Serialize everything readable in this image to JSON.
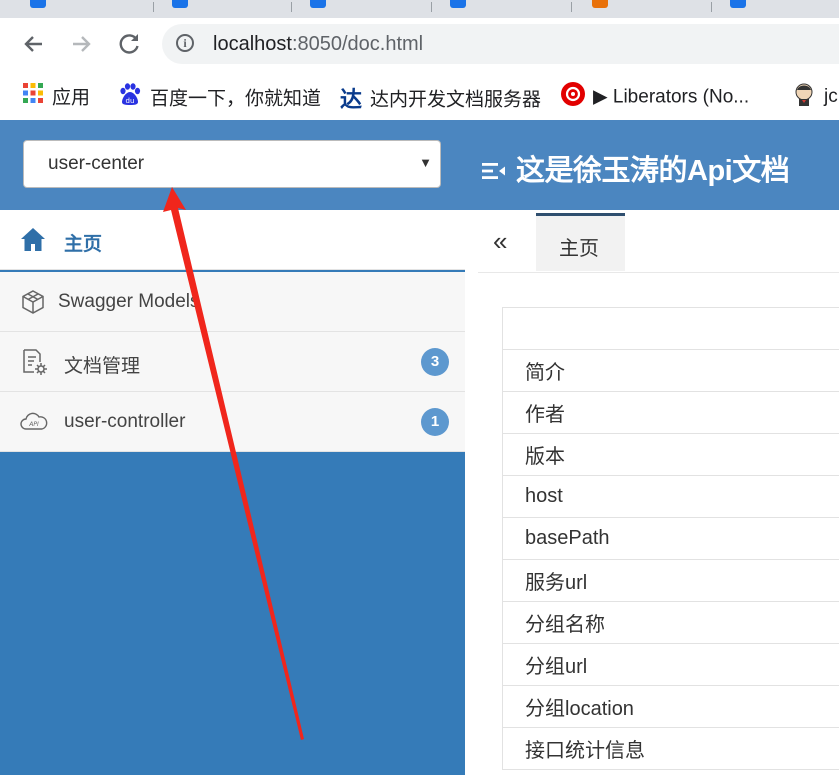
{
  "browser": {
    "url_host": "localhost",
    "url_rest": ":8050/doc.html",
    "tab_favicon_colors": [
      "#1a73e8",
      "#1a73e8",
      "#1a73e8",
      "#1a73e8",
      "#e8710a",
      "#1a73e8"
    ]
  },
  "bookmarks": [
    {
      "label": "应用",
      "icon": "apps-grid-icon"
    },
    {
      "label": "百度一下，你就知道",
      "icon": "baidu-paw-icon"
    },
    {
      "label": "达内开发文档服务器",
      "icon": "tarena-logo-icon"
    },
    {
      "label": "▶ Liberators (No...",
      "icon": "netease-music-icon"
    },
    {
      "label": "jc",
      "icon": "jenkins-avatar-icon"
    }
  ],
  "header": {
    "group_select_value": "user-center",
    "title": "这是徐玉涛的Api文档"
  },
  "sidebar": {
    "items": [
      {
        "label": "主页",
        "icon": "home-icon"
      },
      {
        "label": "Swagger Models",
        "icon": "models-cube-icon"
      },
      {
        "label": "文档管理",
        "icon": "doc-settings-icon",
        "badge": "3"
      },
      {
        "label": "user-controller",
        "icon": "api-cloud-icon",
        "badge": "1"
      }
    ]
  },
  "main": {
    "collapse_glyph": "«",
    "tab_label": "主页",
    "info_rows": [
      "简介",
      "作者",
      "版本",
      "host",
      "basePath",
      "服务url",
      "分组名称",
      "分组url",
      "分组location",
      "接口统计信息"
    ]
  },
  "colors": {
    "header_bg": "#4b86c0",
    "sidebar_bg": "#357bb8",
    "badge_bg": "#5d98cf",
    "annotation_arrow": "#f0261c"
  }
}
